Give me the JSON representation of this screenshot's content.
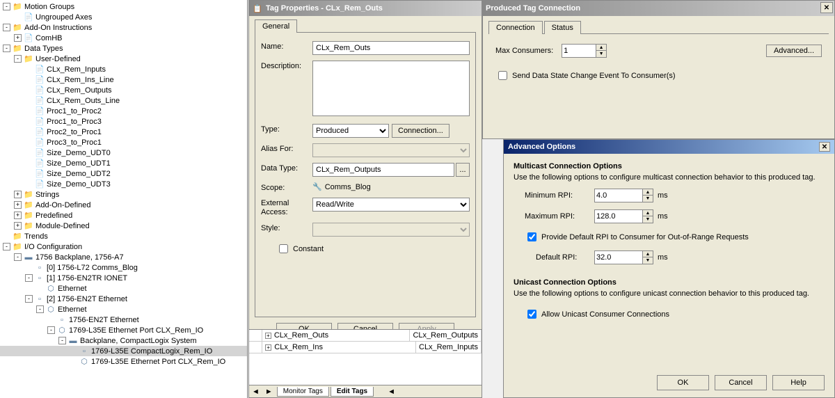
{
  "tree": {
    "items": [
      {
        "indent": 0,
        "toggle": "-",
        "icon": "folder",
        "label": "Motion Groups"
      },
      {
        "indent": 1,
        "toggle": "",
        "icon": "file",
        "label": "Ungrouped Axes"
      },
      {
        "indent": 0,
        "toggle": "-",
        "icon": "folder",
        "label": "Add-On Instructions"
      },
      {
        "indent": 1,
        "toggle": "+",
        "icon": "file",
        "label": "ComHB"
      },
      {
        "indent": 0,
        "toggle": "-",
        "icon": "folder",
        "label": "Data Types"
      },
      {
        "indent": 1,
        "toggle": "-",
        "icon": "folder",
        "label": "User-Defined"
      },
      {
        "indent": 2,
        "toggle": "",
        "icon": "file",
        "label": "CLx_Rem_Inputs"
      },
      {
        "indent": 2,
        "toggle": "",
        "icon": "file",
        "label": "CLx_Rem_Ins_Line"
      },
      {
        "indent": 2,
        "toggle": "",
        "icon": "file",
        "label": "CLx_Rem_Outputs"
      },
      {
        "indent": 2,
        "toggle": "",
        "icon": "file",
        "label": "CLx_Rem_Outs_Line"
      },
      {
        "indent": 2,
        "toggle": "",
        "icon": "file",
        "label": "Proc1_to_Proc2"
      },
      {
        "indent": 2,
        "toggle": "",
        "icon": "file",
        "label": "Proc1_to_Proc3"
      },
      {
        "indent": 2,
        "toggle": "",
        "icon": "file",
        "label": "Proc2_to_Proc1"
      },
      {
        "indent": 2,
        "toggle": "",
        "icon": "file",
        "label": "Proc3_to_Proc1"
      },
      {
        "indent": 2,
        "toggle": "",
        "icon": "file",
        "label": "Size_Demo_UDT0"
      },
      {
        "indent": 2,
        "toggle": "",
        "icon": "file",
        "label": "Size_Demo_UDT1"
      },
      {
        "indent": 2,
        "toggle": "",
        "icon": "file",
        "label": "Size_Demo_UDT2"
      },
      {
        "indent": 2,
        "toggle": "",
        "icon": "file",
        "label": "Size_Demo_UDT3"
      },
      {
        "indent": 1,
        "toggle": "+",
        "icon": "folder",
        "label": "Strings"
      },
      {
        "indent": 1,
        "toggle": "+",
        "icon": "folder",
        "label": "Add-On-Defined"
      },
      {
        "indent": 1,
        "toggle": "+",
        "icon": "folder",
        "label": "Predefined"
      },
      {
        "indent": 1,
        "toggle": "+",
        "icon": "folder",
        "label": "Module-Defined"
      },
      {
        "indent": 0,
        "toggle": "",
        "icon": "folder",
        "label": "Trends"
      },
      {
        "indent": 0,
        "toggle": "-",
        "icon": "folder",
        "label": "I/O Configuration"
      },
      {
        "indent": 1,
        "toggle": "-",
        "icon": "device",
        "label": "1756 Backplane, 1756-A7"
      },
      {
        "indent": 2,
        "toggle": "",
        "icon": "module",
        "label": "[0] 1756-L72 Comms_Blog"
      },
      {
        "indent": 2,
        "toggle": "-",
        "icon": "module",
        "label": "[1] 1756-EN2TR IONET"
      },
      {
        "indent": 3,
        "toggle": "",
        "icon": "net",
        "label": "Ethernet"
      },
      {
        "indent": 2,
        "toggle": "-",
        "icon": "module",
        "label": "[2] 1756-EN2T Ethernet"
      },
      {
        "indent": 3,
        "toggle": "-",
        "icon": "net",
        "label": "Ethernet"
      },
      {
        "indent": 4,
        "toggle": "",
        "icon": "module",
        "label": "1756-EN2T Ethernet"
      },
      {
        "indent": 4,
        "toggle": "-",
        "icon": "net",
        "label": "1769-L35E Ethernet Port CLX_Rem_IO"
      },
      {
        "indent": 5,
        "toggle": "-",
        "icon": "device",
        "label": "Backplane, CompactLogix System"
      },
      {
        "indent": 6,
        "toggle": "",
        "icon": "module",
        "label": "1769-L35E CompactLogix_Rem_IO",
        "selected": true
      },
      {
        "indent": 6,
        "toggle": "",
        "icon": "net",
        "label": "1769-L35E Ethernet Port CLX_Rem_IO"
      }
    ]
  },
  "tagProps": {
    "title": "Tag Properties - CLx_Rem_Outs",
    "tabs": {
      "general": "General"
    },
    "fields": {
      "nameLabel": "Name:",
      "nameValue": "CLx_Rem_Outs",
      "descLabel": "Description:",
      "typeLabel": "Type:",
      "typeValue": "Produced",
      "connectionBtn": "Connection...",
      "aliasLabel": "Alias For:",
      "dataTypeLabel": "Data Type:",
      "dataTypeValue": "CLx_Rem_Outputs",
      "scopeLabel": "Scope:",
      "scopeValue": "Comms_Blog",
      "extAccessLabel": "External Access:",
      "extAccessValue": "Read/Write",
      "styleLabel": "Style:",
      "constantLabel": "Constant"
    },
    "buttons": {
      "ok": "OK",
      "cancel": "Cancel",
      "apply": "Apply"
    }
  },
  "grid": {
    "rows": [
      {
        "name": "CLx_Rem_Outs",
        "type": "CLx_Rem_Outputs"
      },
      {
        "name": "CLx_Rem_Ins",
        "type": "CLx_Rem_Inputs"
      }
    ]
  },
  "bottomTabs": {
    "monitor": "Monitor Tags",
    "edit": "Edit Tags"
  },
  "prodTag": {
    "title": "Produced Tag Connection",
    "tabs": {
      "connection": "Connection",
      "status": "Status"
    },
    "maxConsLabel": "Max Consumers:",
    "maxConsValue": "1",
    "sendDataLabel": "Send Data State Change Event To Consumer(s)",
    "advancedBtn": "Advanced..."
  },
  "advOpts": {
    "title": "Advanced Options",
    "multicast": {
      "title": "Multicast Connection Options",
      "desc": "Use the following options to configure multicast connection behavior to this produced tag.",
      "minRpiLabel": "Minimum RPI:",
      "minRpiValue": "4.0",
      "maxRpiLabel": "Maximum RPI:",
      "maxRpiValue": "128.0",
      "provideDefLabel": "Provide Default RPI to Consumer for Out-of-Range Requests",
      "defRpiLabel": "Default RPI:",
      "defRpiValue": "32.0",
      "unit": "ms"
    },
    "unicast": {
      "title": "Unicast Connection Options",
      "desc": "Use the following options to configure unicast connection behavior to this produced tag.",
      "allowLabel": "Allow Unicast Consumer Connections"
    },
    "buttons": {
      "ok": "OK",
      "cancel": "Cancel",
      "help": "Help"
    }
  }
}
